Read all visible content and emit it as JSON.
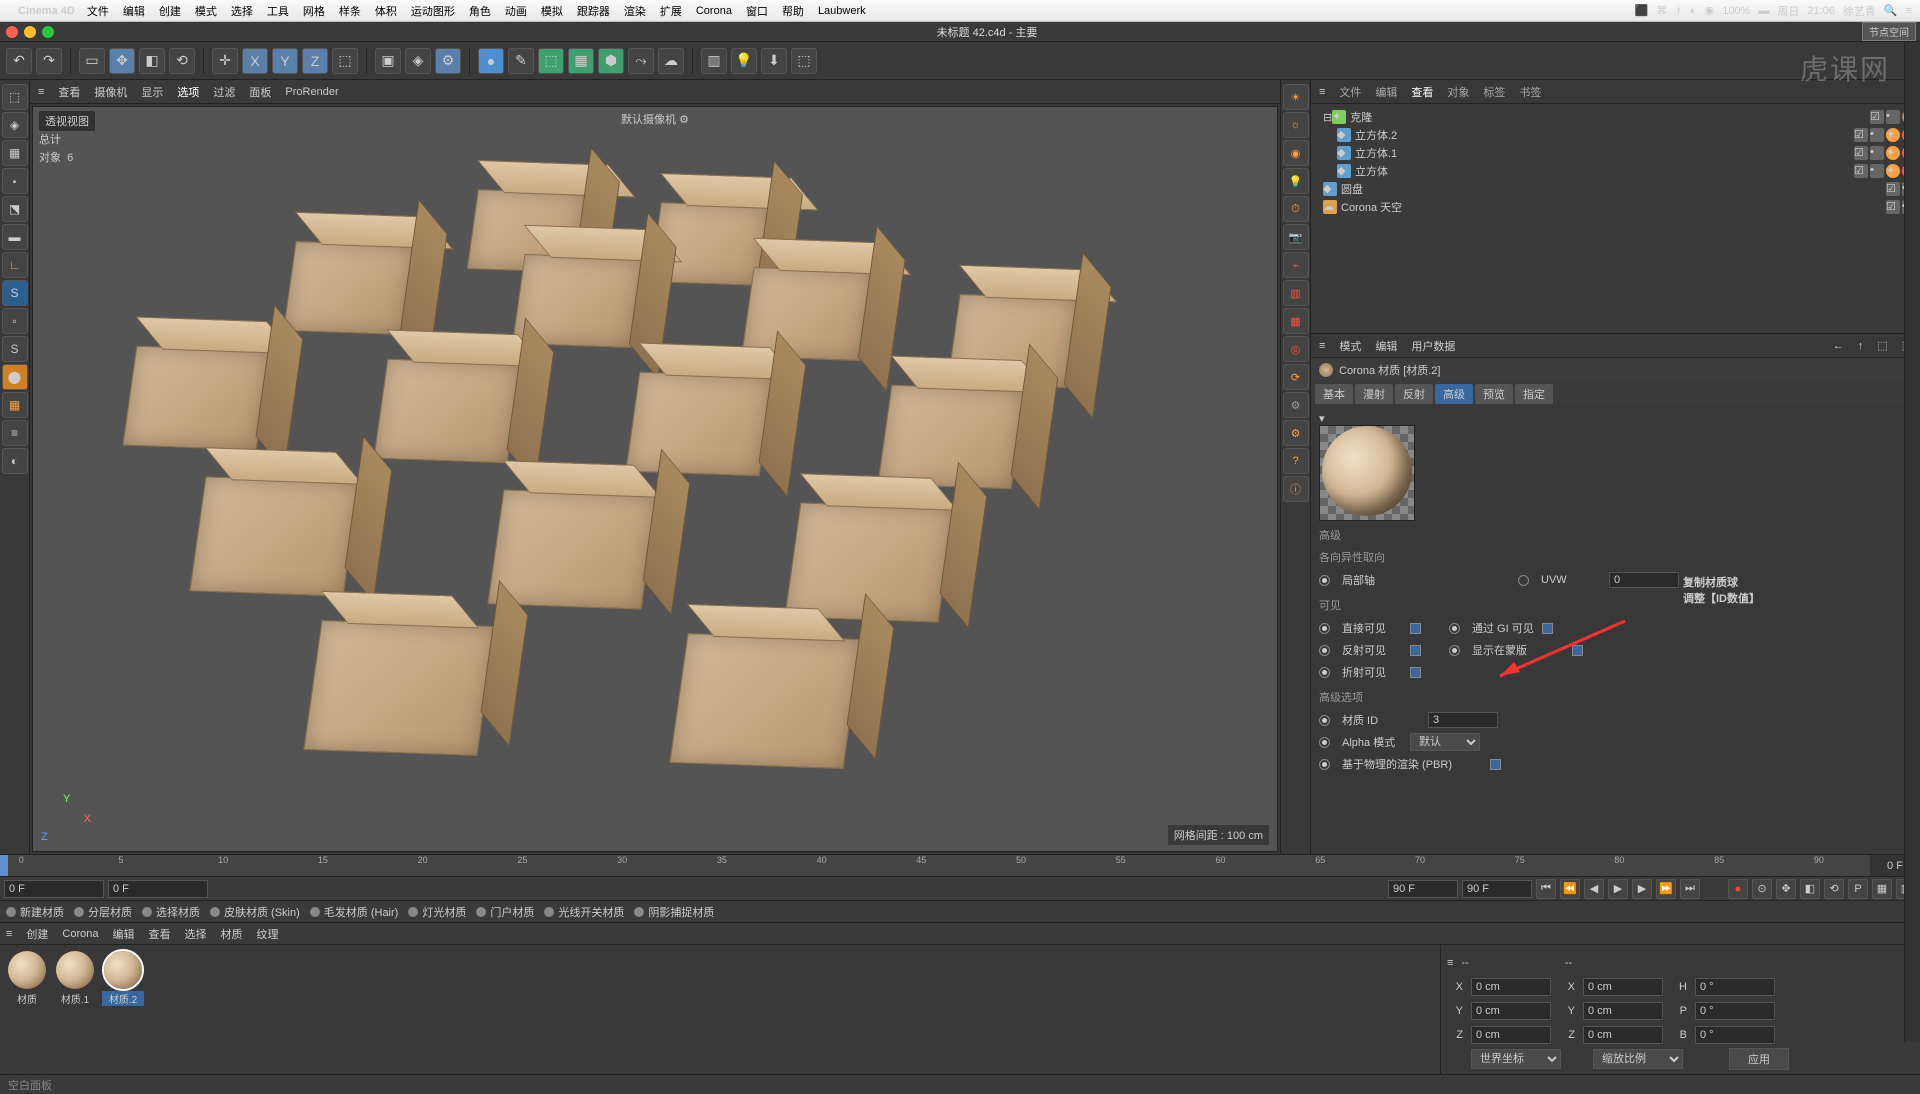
{
  "mac": {
    "apple": "",
    "app": "Cinema 4D",
    "menus": [
      "文件",
      "编辑",
      "创建",
      "模式",
      "选择",
      "工具",
      "网格",
      "样条",
      "体积",
      "运动图形",
      "角色",
      "动画",
      "模拟",
      "跟踪器",
      "渲染",
      "扩展",
      "Corona",
      "窗口",
      "帮助",
      "Laubwerk"
    ],
    "right": {
      "battery": "100%",
      "day": "周日",
      "time": "21:06",
      "user": "徐艺青"
    }
  },
  "window_title": "未标题 42.c4d - 主要",
  "node_badge": "节点空间",
  "watermark": "虎课网",
  "viewport": {
    "tabs": [
      "查看",
      "摄像机",
      "显示",
      "选项",
      "过滤",
      "面板",
      "ProRender"
    ],
    "perspective": "透视视图",
    "camera": "默认摄像机",
    "stats_total": "总计",
    "stats_objects_label": "对象",
    "stats_objects": "6",
    "grid": "网格间距 : 100 cm"
  },
  "object_manager": {
    "tabs": [
      "文件",
      "编辑",
      "查看",
      "对象",
      "标签",
      "书签"
    ],
    "tree": [
      {
        "name": "克隆",
        "indent": 0,
        "color": "#7fcf5f"
      },
      {
        "name": "立方体.2",
        "indent": 1,
        "color": "#5f9fcf"
      },
      {
        "name": "立方体.1",
        "indent": 1,
        "color": "#5f9fcf"
      },
      {
        "name": "立方体",
        "indent": 1,
        "color": "#5f9fcf"
      },
      {
        "name": "圆盘",
        "indent": 0,
        "color": "#5f9fcf"
      },
      {
        "name": "Corona 天空",
        "indent": 0,
        "color": "#df9f4f"
      }
    ]
  },
  "attr": {
    "head": [
      "模式",
      "编辑",
      "用户数据"
    ],
    "title": "Corona 材质 [材质.2]",
    "tabs": [
      "基本",
      "漫射",
      "反射",
      "高级",
      "预览",
      "指定"
    ],
    "active_tab": 3,
    "section_advanced": "高级",
    "anisotropy": "各向异性取向",
    "local_axis": "局部轴",
    "uvw": "UVW",
    "uvw_val": "0",
    "visibility": "可见",
    "direct_visible": "直接可见",
    "gi_visible": "通过 GI 可见",
    "reflect_visible": "反射可见",
    "mask_show": "显示在蒙版",
    "refract_visible": "折射可见",
    "advanced_options": "高级选项",
    "material_id_label": "材质 ID",
    "material_id_value": "3",
    "alpha_mode_label": "Alpha 模式",
    "alpha_mode_value": "默认",
    "pbr_label": "基于物理的渲染 (PBR)"
  },
  "annotation": {
    "line1": "复制材质球",
    "line2": "调整【ID数值】"
  },
  "timeline": {
    "start": "0 F",
    "current": "0 F",
    "end": "90 F",
    "end2": "90 F",
    "ticks": [
      "0",
      "5",
      "10",
      "15",
      "20",
      "25",
      "30",
      "35",
      "40",
      "45",
      "50",
      "55",
      "60",
      "65",
      "70",
      "75",
      "80",
      "85",
      "90"
    ],
    "frame_label": "0 F"
  },
  "material_cat": [
    "新建材质",
    "分层材质",
    "选择材质",
    "皮肤材质 (Skin)",
    "毛发材质 (Hair)",
    "灯光材质",
    "门户材质",
    "光线开关材质",
    "阴影捕捉材质"
  ],
  "material_menu": [
    "创建",
    "Corona",
    "编辑",
    "查看",
    "选择",
    "材质",
    "纹理"
  ],
  "materials": [
    {
      "name": "材质"
    },
    {
      "name": "材质.1"
    },
    {
      "name": "材质.2",
      "selected": true
    }
  ],
  "coord": {
    "x": "0 cm",
    "y": "0 cm",
    "z": "0 cm",
    "x2": "0 cm",
    "y2": "0 cm",
    "z2": "0 cm",
    "h": "0 °",
    "p": "0 °",
    "b": "0 °",
    "world": "世界坐标",
    "scale": "缩放比例",
    "apply": "应用"
  },
  "statusbar": "空白面板"
}
